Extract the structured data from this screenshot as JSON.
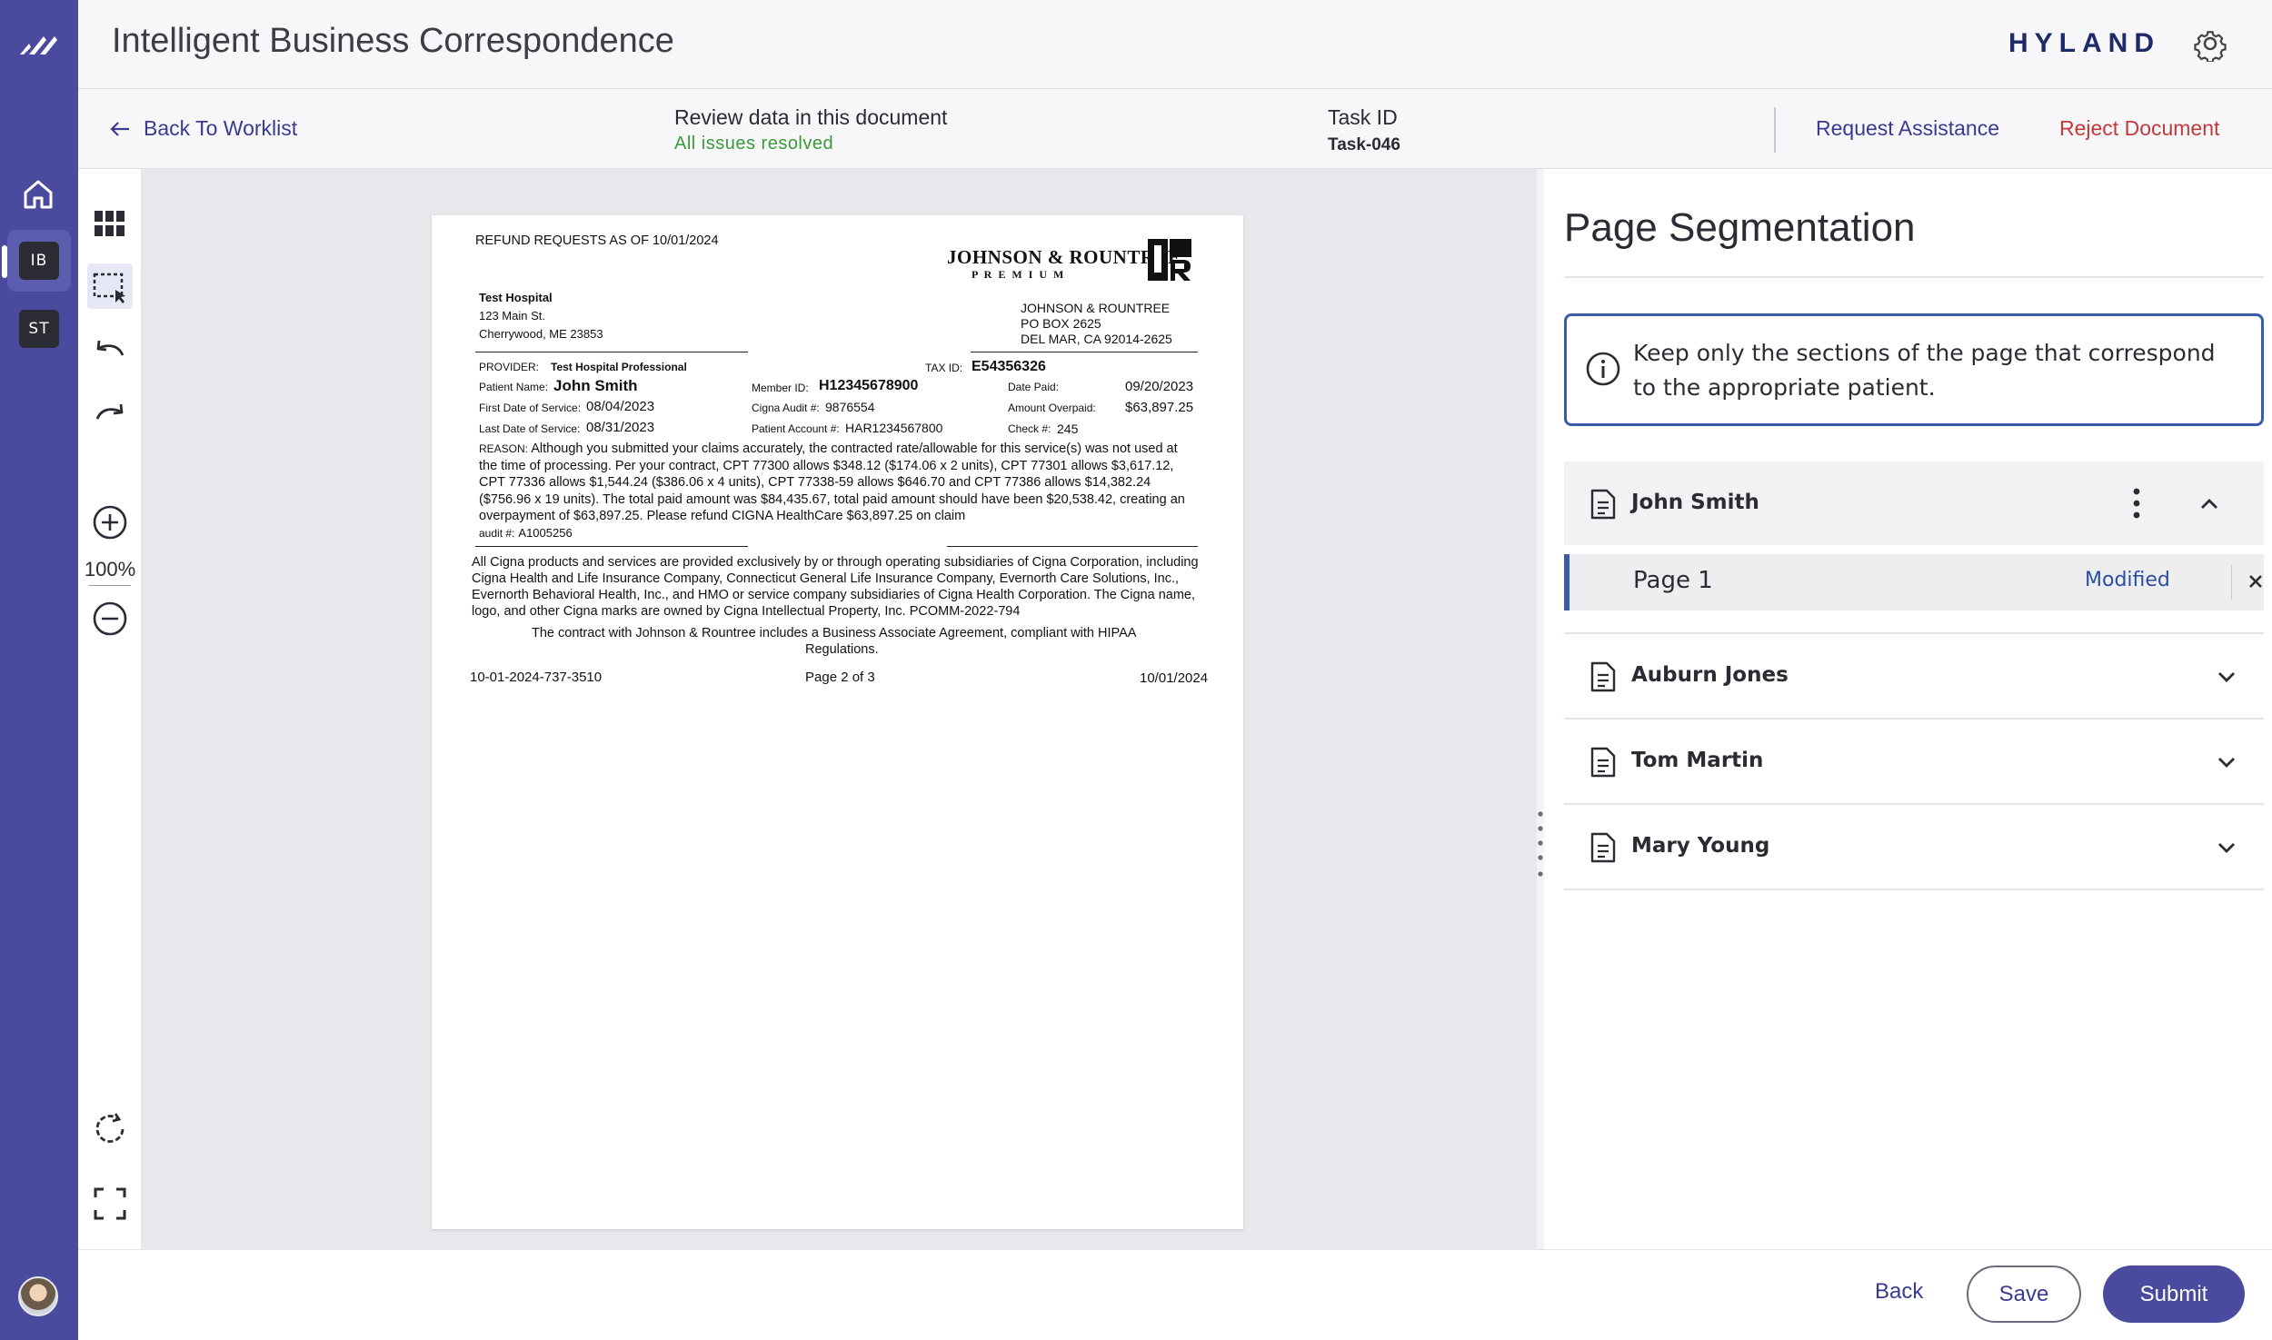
{
  "rail": {
    "badges": [
      "IB",
      "ST"
    ]
  },
  "header": {
    "title": "Intelligent Business Correspondence",
    "brand": "HYLAND"
  },
  "subheader": {
    "back_label": "Back To Worklist",
    "review_label": "Review data in this document",
    "review_status": "All issues resolved",
    "task_label": "Task ID",
    "task_value": "Task-046",
    "request_label": "Request Assistance",
    "reject_label": "Reject Document"
  },
  "tools": {
    "zoom": "100%"
  },
  "document": {
    "heading": "REFUND REQUESTS AS OF 10/01/2024",
    "logo_name": "JOHNSON & ROUNTREE",
    "logo_sub": "P R E M I U M",
    "hospital_name": "Test Hospital",
    "hospital_street": "123 Main St.",
    "hospital_city": "Cherrywood, ME 23853",
    "company_name": "JOHNSON & ROUNTREE",
    "company_box": "PO BOX 2625",
    "company_city": "DEL MAR, CA 92014-2625",
    "provider_label": "PROVIDER:",
    "provider_value": "Test Hospital Professional",
    "taxid_label": "TAX ID:",
    "taxid_value": "E54356326",
    "patient_label": "Patient Name:",
    "patient_value": "John Smith",
    "member_label": "Member ID:",
    "member_value": "H12345678900",
    "datepaid_label": "Date Paid:",
    "datepaid_value": "09/20/2023",
    "first_dos_label": "First Date of Service:",
    "first_dos_value": "08/04/2023",
    "audit_label": "Cigna Audit #:",
    "audit_value": "9876554",
    "overpaid_label": "Amount Overpaid:",
    "overpaid_value": "$63,897.25",
    "last_dos_label": "Last Date of Service:",
    "last_dos_value": "08/31/2023",
    "account_label": "Patient Account #:",
    "account_value": "HAR1234567800",
    "check_label": "Check #:",
    "check_value": "245",
    "reason_label": "REASON:",
    "reason_text": "Although you submitted your claims accurately, the contracted rate/allowable for this service(s) was not used at the time of processing. Per your contract, CPT 77300 allows $348.12 ($174.06 x 2 units), CPT 77301 allows $3,617.12, CPT 77336 allows $1,544.24 ($386.06 x 4 units), CPT 77338-59 allows $646.70 and CPT 77386 allows $14,382.24 ($756.96 x 19 units). The total paid amount was $84,435.67, total paid amount should have been $20,538.42, creating an overpayment of $63,897.25. Please refund CIGNA HealthCare $63,897.25 on claim",
    "audit_line_label": "audit #:",
    "audit_line_value": "A1005256",
    "disclaimer": "All Cigna products and services are provided exclusively by or through operating subsidiaries of Cigna Corporation, including Cigna Health and Life Insurance Company, Connecticut General Life Insurance Company, Evernorth Care Solutions, Inc., Evernorth Behavioral Health, Inc., and HMO or service company subsidiaries of Cigna Health Corporation. The Cigna name, logo, and other Cigna marks are owned by Cigna Intellectual Property, Inc. PCOMM-2022-794",
    "contract_line1": "The contract with Johnson & Rountree includes a Business Associate Agreement, compliant with HIPAA",
    "contract_line2": "Regulations.",
    "footer_left": "10-01-2024-737-3510",
    "footer_center": "Page 2 of 3",
    "footer_right": "10/01/2024"
  },
  "panel": {
    "title": "Page Segmentation",
    "info_text": "Keep only the sections of the page that correspond to the appropriate patient.",
    "patients": [
      {
        "name": "John Smith",
        "expanded": true
      },
      {
        "name": "Auburn Jones",
        "expanded": false
      },
      {
        "name": "Tom Martin",
        "expanded": false
      },
      {
        "name": "Mary Young",
        "expanded": false
      }
    ],
    "page_row": {
      "label": "Page 1",
      "status": "Modified"
    }
  },
  "footer": {
    "back_label": "Back",
    "save_label": "Save",
    "submit_label": "Submit"
  },
  "colors": {
    "rail": "#4a4a9e",
    "accent": "#3a5ba8",
    "link": "#3a3a90",
    "success": "#3a9a3a",
    "danger": "#c23b3b"
  },
  "icons": [
    "logo-icon",
    "home-icon",
    "gear-icon",
    "arrow-left-icon",
    "grid-icon",
    "selection-icon",
    "undo-icon",
    "redo-icon",
    "zoom-in-icon",
    "zoom-out-icon",
    "refresh-icon",
    "fullscreen-icon",
    "info-icon",
    "document-icon",
    "kebab-icon",
    "chevron-up-icon",
    "chevron-down-icon",
    "close-icon"
  ]
}
